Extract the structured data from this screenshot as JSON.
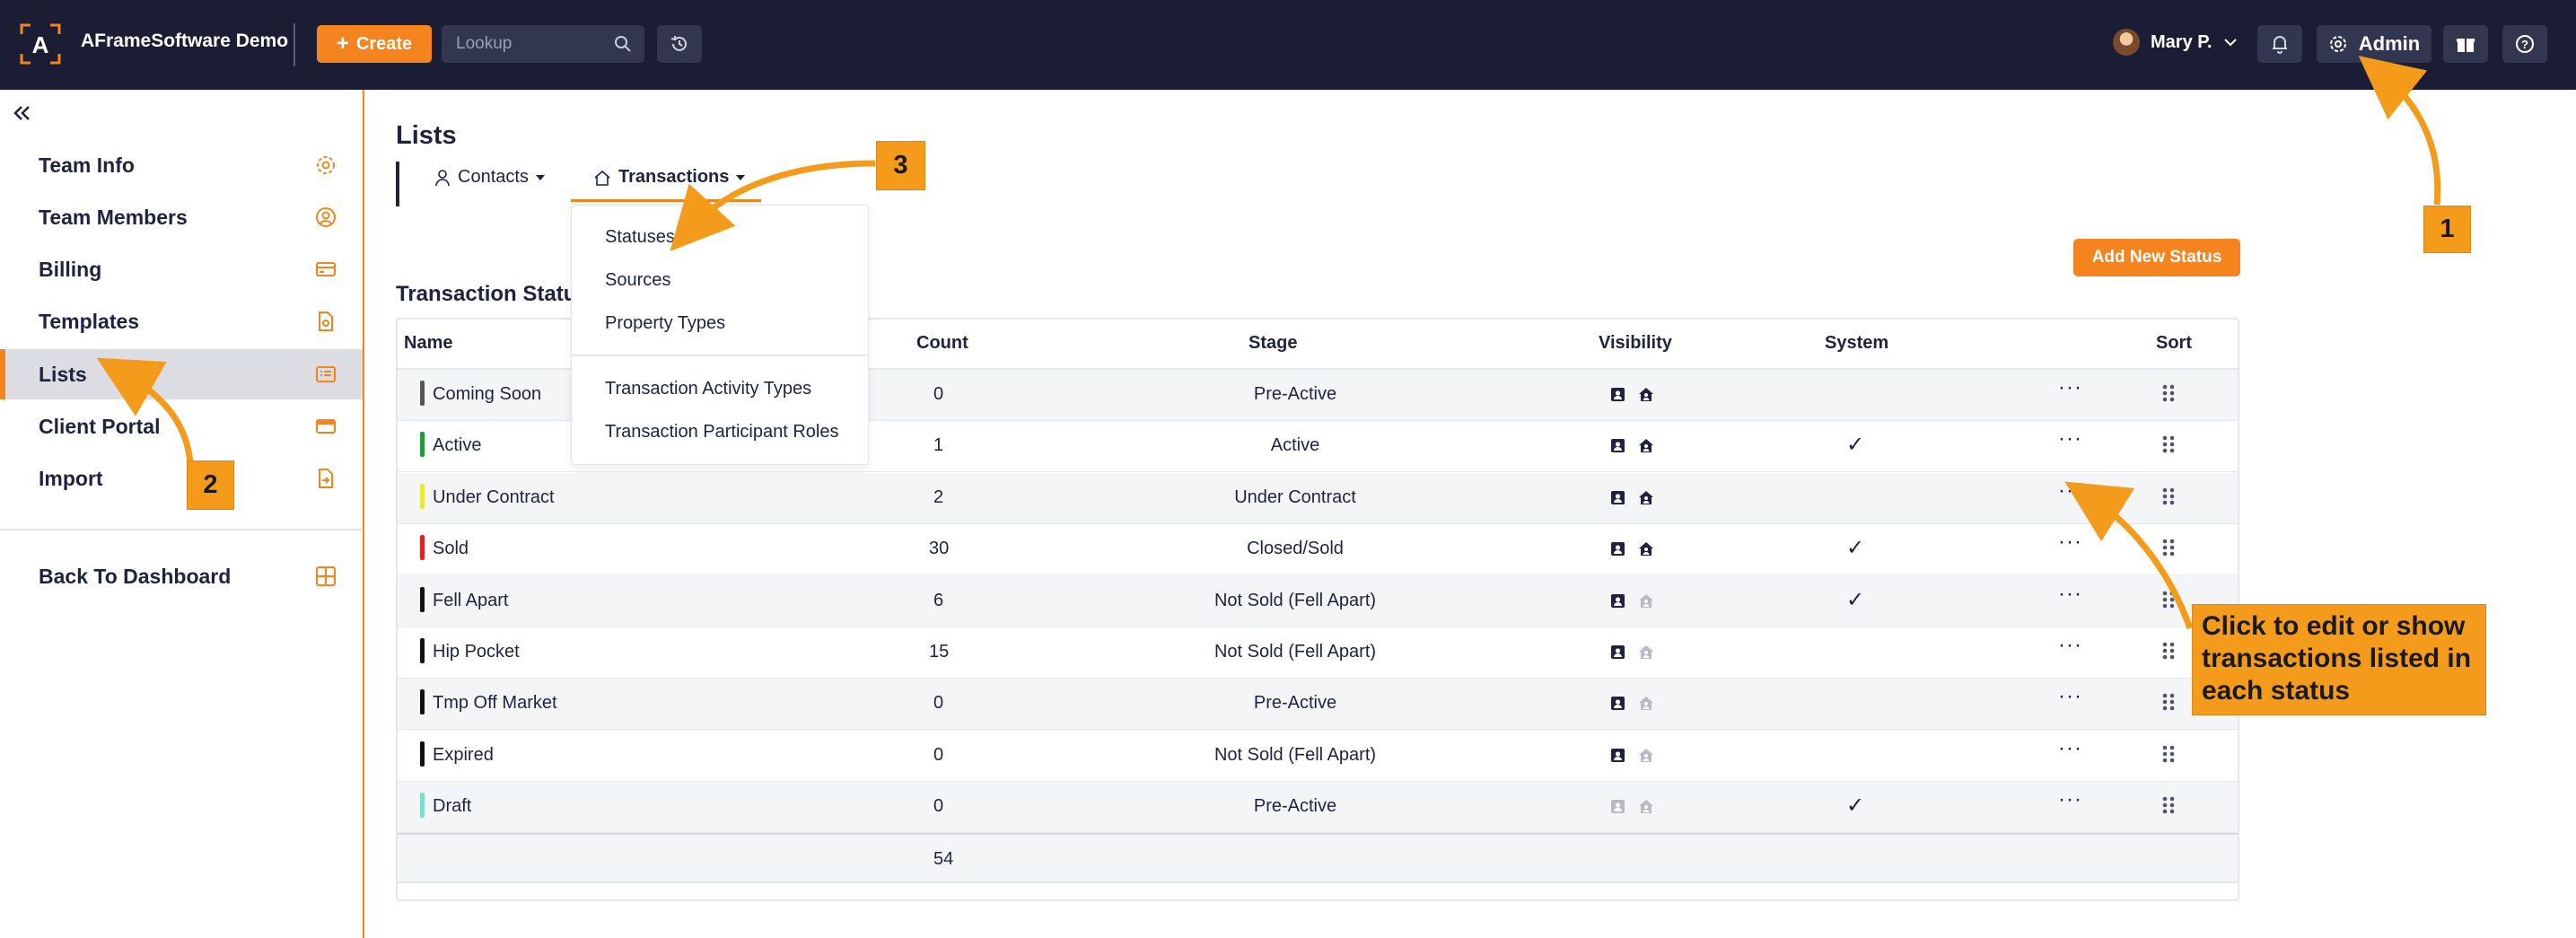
{
  "topbar": {
    "app_name": "AFrameSoftware Demo",
    "logo_letter": "A",
    "create_label": "Create",
    "lookup_placeholder": "Lookup",
    "user_name": "Mary P.",
    "admin_label": "Admin"
  },
  "sidebar": {
    "items": [
      {
        "label": "Team Info",
        "icon": "gear-icon"
      },
      {
        "label": "Team Members",
        "icon": "user-circle-icon"
      },
      {
        "label": "Billing",
        "icon": "credit-card-icon"
      },
      {
        "label": "Templates",
        "icon": "document-icon"
      },
      {
        "label": "Lists",
        "icon": "list-icon",
        "active": true
      },
      {
        "label": "Client Portal",
        "icon": "card-icon"
      },
      {
        "label": "Import",
        "icon": "file-import-icon"
      }
    ],
    "back_label": "Back To Dashboard"
  },
  "main": {
    "title": "Lists",
    "tabs": [
      {
        "label": "Contacts"
      },
      {
        "label": "Transactions",
        "active": true
      }
    ],
    "dropdown": {
      "items": [
        "Statuses",
        "Sources",
        "Property Types",
        "Transaction Activity Types",
        "Transaction Participant Roles"
      ]
    },
    "section_title": "Transaction Statu",
    "add_button": "Add New Status",
    "table": {
      "headers": {
        "name": "Name",
        "count": "Count",
        "stage": "Stage",
        "visibility": "Visibility",
        "system": "System",
        "sort": "Sort"
      },
      "rows": [
        {
          "name": "Coming Soon",
          "color": "#555555",
          "count": "0",
          "stage": "Pre-Active",
          "vis1": true,
          "vis2": true,
          "system": false
        },
        {
          "name": "Active",
          "color": "#1e9e3a",
          "count": "1",
          "stage": "Active",
          "vis1": true,
          "vis2": true,
          "system": true
        },
        {
          "name": "Under Contract",
          "color": "#e8e83a",
          "count": "2",
          "stage": "Under Contract",
          "vis1": true,
          "vis2": true,
          "system": false
        },
        {
          "name": "Sold",
          "color": "#e02424",
          "count": "30",
          "stage": "Closed/Sold",
          "vis1": true,
          "vis2": true,
          "system": true
        },
        {
          "name": "Fell Apart",
          "color": "#111111",
          "count": "6",
          "stage": "Not Sold (Fell Apart)",
          "vis1": true,
          "vis2": false,
          "system": true
        },
        {
          "name": "Hip Pocket",
          "color": "#111111",
          "count": "15",
          "stage": "Not Sold (Fell Apart)",
          "vis1": true,
          "vis2": false,
          "system": false
        },
        {
          "name": "Tmp Off Market",
          "color": "#111111",
          "count": "0",
          "stage": "Pre-Active",
          "vis1": true,
          "vis2": false,
          "system": false
        },
        {
          "name": "Expired",
          "color": "#111111",
          "count": "0",
          "stage": "Not Sold (Fell Apart)",
          "vis1": true,
          "vis2": false,
          "system": false
        },
        {
          "name": "Draft",
          "color": "#7fdccc",
          "count": "0",
          "stage": "Pre-Active",
          "vis1": false,
          "vis2": false,
          "system": true
        }
      ],
      "total": "54"
    }
  },
  "annotations": {
    "badge1": "1",
    "badge2": "2",
    "badge3": "3",
    "callout_line1": "Click to edit or show",
    "callout_line2": "transactions listed in",
    "callout_line3": "each status"
  },
  "colors": {
    "accent": "#f5841f",
    "topbar": "#1b1d35",
    "annotation": "#f59b1c"
  }
}
